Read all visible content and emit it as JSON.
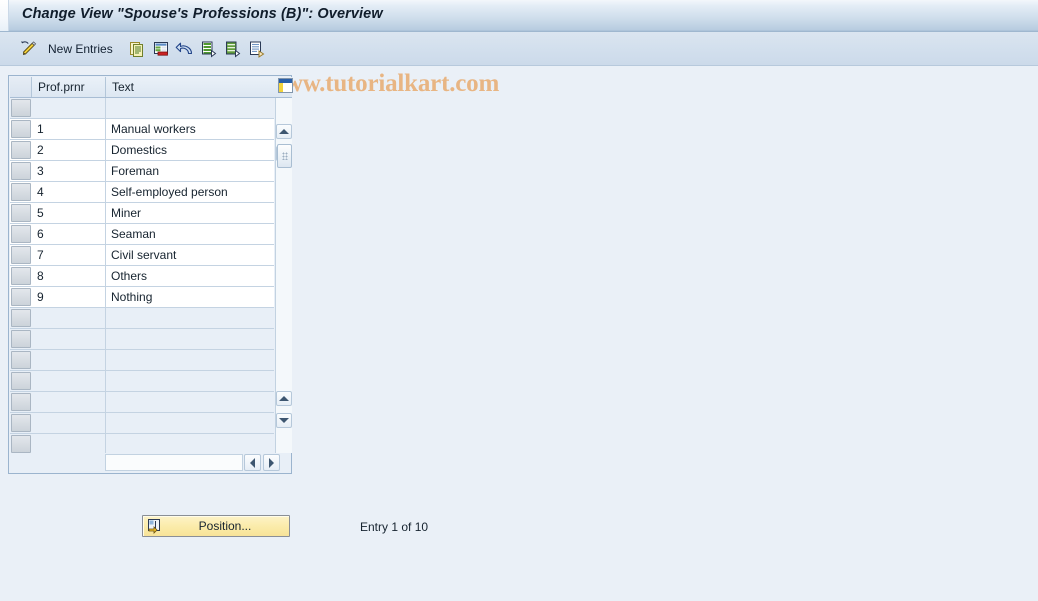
{
  "window": {
    "title": "Change View \"Spouse's Professions (B)\": Overview"
  },
  "toolbar": {
    "change_icon": "pencil-icon",
    "new_entries_label": "New Entries",
    "icons": [
      {
        "name": "copy-icon"
      },
      {
        "name": "delete-row-icon"
      },
      {
        "name": "undo-icon"
      },
      {
        "name": "select-all-icon"
      },
      {
        "name": "deselect-all-icon"
      },
      {
        "name": "details-icon"
      }
    ],
    "watermark": "www.tutorialkart.com"
  },
  "table": {
    "config_icon": "column-config-icon",
    "columns": [
      {
        "key": "prof",
        "label": "Prof.prnr"
      },
      {
        "key": "text",
        "label": "Text"
      }
    ],
    "rows": [
      {
        "prof": "",
        "text": ""
      },
      {
        "prof": "1",
        "text": "Manual workers"
      },
      {
        "prof": "2",
        "text": "Domestics"
      },
      {
        "prof": "3",
        "text": "Foreman"
      },
      {
        "prof": "4",
        "text": "Self-employed person"
      },
      {
        "prof": "5",
        "text": "Miner"
      },
      {
        "prof": "6",
        "text": "Seaman"
      },
      {
        "prof": "7",
        "text": "Civil servant"
      },
      {
        "prof": "8",
        "text": "Others"
      },
      {
        "prof": "9",
        "text": "Nothing"
      },
      {
        "prof": "",
        "text": ""
      },
      {
        "prof": "",
        "text": ""
      },
      {
        "prof": "",
        "text": ""
      },
      {
        "prof": "",
        "text": ""
      },
      {
        "prof": "",
        "text": ""
      },
      {
        "prof": "",
        "text": ""
      },
      {
        "prof": "",
        "text": ""
      }
    ],
    "scroll": {
      "up_icon": "scroll-up-icon",
      "down_icon": "scroll-down-icon",
      "thumb": "scroll-thumb",
      "left_icon": "scroll-left-icon",
      "right_icon": "scroll-right-icon"
    }
  },
  "footer": {
    "position_button": {
      "label": "Position...",
      "icon": "position-icon"
    },
    "entry_status": "Entry 1 of 10"
  },
  "colors": {
    "title_bar_top": "#f3f7fb",
    "title_bar_bottom": "#a8bfd6",
    "toolbar": "#d2dfed",
    "page_background": "#eaf0f7",
    "panel_border": "#9bb4ce",
    "watermark": "#e8b583",
    "button_yellow": "#fbecab"
  }
}
